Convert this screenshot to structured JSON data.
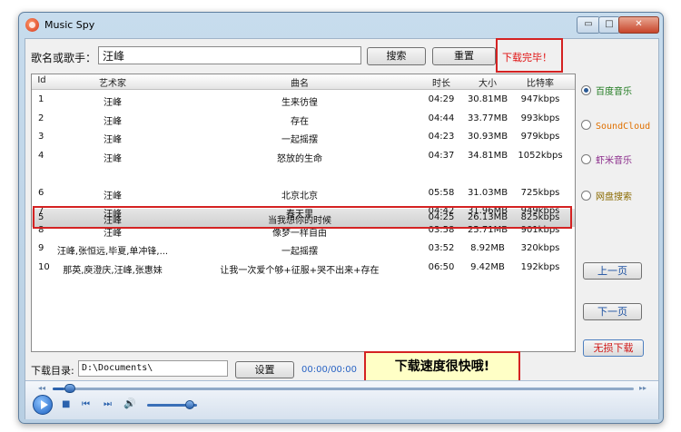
{
  "window": {
    "title": "Music  Spy",
    "minimize_glyph": "▭",
    "maximize_glyph": "□",
    "close_glyph": "✕"
  },
  "search": {
    "label": "歌名或歌手：",
    "value": "汪峰",
    "search_button": "搜索",
    "reset_button": "重置",
    "status": "下载完毕！"
  },
  "table": {
    "columns": {
      "id": "Id",
      "artist": "艺术家",
      "song": "曲名",
      "duration": "时长",
      "size": "大小",
      "bitrate": "比特率"
    },
    "selected_row": 4,
    "rows": [
      {
        "id": "1",
        "artist": "汪峰",
        "song": "生来彷徨",
        "duration": "04:29",
        "size": "30.81MB",
        "bitrate": "947kbps"
      },
      {
        "id": "2",
        "artist": "汪峰",
        "song": "存在",
        "duration": "04:44",
        "size": "33.77MB",
        "bitrate": "993kbps"
      },
      {
        "id": "3",
        "artist": "汪峰",
        "song": "一起摇摆",
        "duration": "04:23",
        "size": "30.93MB",
        "bitrate": "979kbps"
      },
      {
        "id": "4",
        "artist": "汪峰",
        "song": "怒放的生命",
        "duration": "04:37",
        "size": "34.81MB",
        "bitrate": "1052kbps"
      },
      {
        "id": "5",
        "artist": "汪峰",
        "song": "当我想你的时候",
        "duration": "04:25",
        "size": "26.13MB",
        "bitrate": "825kbps"
      },
      {
        "id": "6",
        "artist": "汪峰",
        "song": "北京北京",
        "duration": "05:58",
        "size": "31.03MB",
        "bitrate": "725kbps"
      },
      {
        "id": "7",
        "artist": "汪峰",
        "song": "春天里",
        "duration": "04:42",
        "size": "31.96MB",
        "bitrate": "949kbps"
      },
      {
        "id": "8",
        "artist": "汪峰",
        "song": "像梦一样自由",
        "duration": "03:58",
        "size": "25.71MB",
        "bitrate": "901kbps"
      },
      {
        "id": "9",
        "artist": "汪峰,张恒远,毕夏,单冲锋,...",
        "song": "一起摇摆",
        "duration": "03:52",
        "size": "8.92MB",
        "bitrate": "320kbps"
      },
      {
        "id": "10",
        "artist": "那英,庾澄庆,汪峰,张惠妹",
        "song": "让我一次爱个够+征服+哭不出来+存在",
        "duration": "06:50",
        "size": "9.42MB",
        "bitrate": "192kbps"
      }
    ]
  },
  "callout": "下载速度很快哦!",
  "sources": [
    {
      "label": "百度音乐",
      "selected": true
    },
    {
      "label": "SoundCloud",
      "selected": false
    },
    {
      "label": "虾米音乐",
      "selected": false
    },
    {
      "label": "网盘搜索",
      "selected": false
    }
  ],
  "paging": {
    "prev": "上一页",
    "next": "下一页",
    "lossless": "无损下载"
  },
  "download": {
    "label": "下载目录:",
    "path": "D:\\Documents\\",
    "settings_button": "设置",
    "time": "00:00/00:00"
  },
  "player": {
    "progress": 0.02,
    "volume": 0.85,
    "seek_back_glyph": "◂◂",
    "seek_fwd_glyph": "▸▸",
    "stop_glyph": "■",
    "prev_glyph": "⏮",
    "next_glyph": "⏭",
    "volume_glyph": "🔊"
  }
}
